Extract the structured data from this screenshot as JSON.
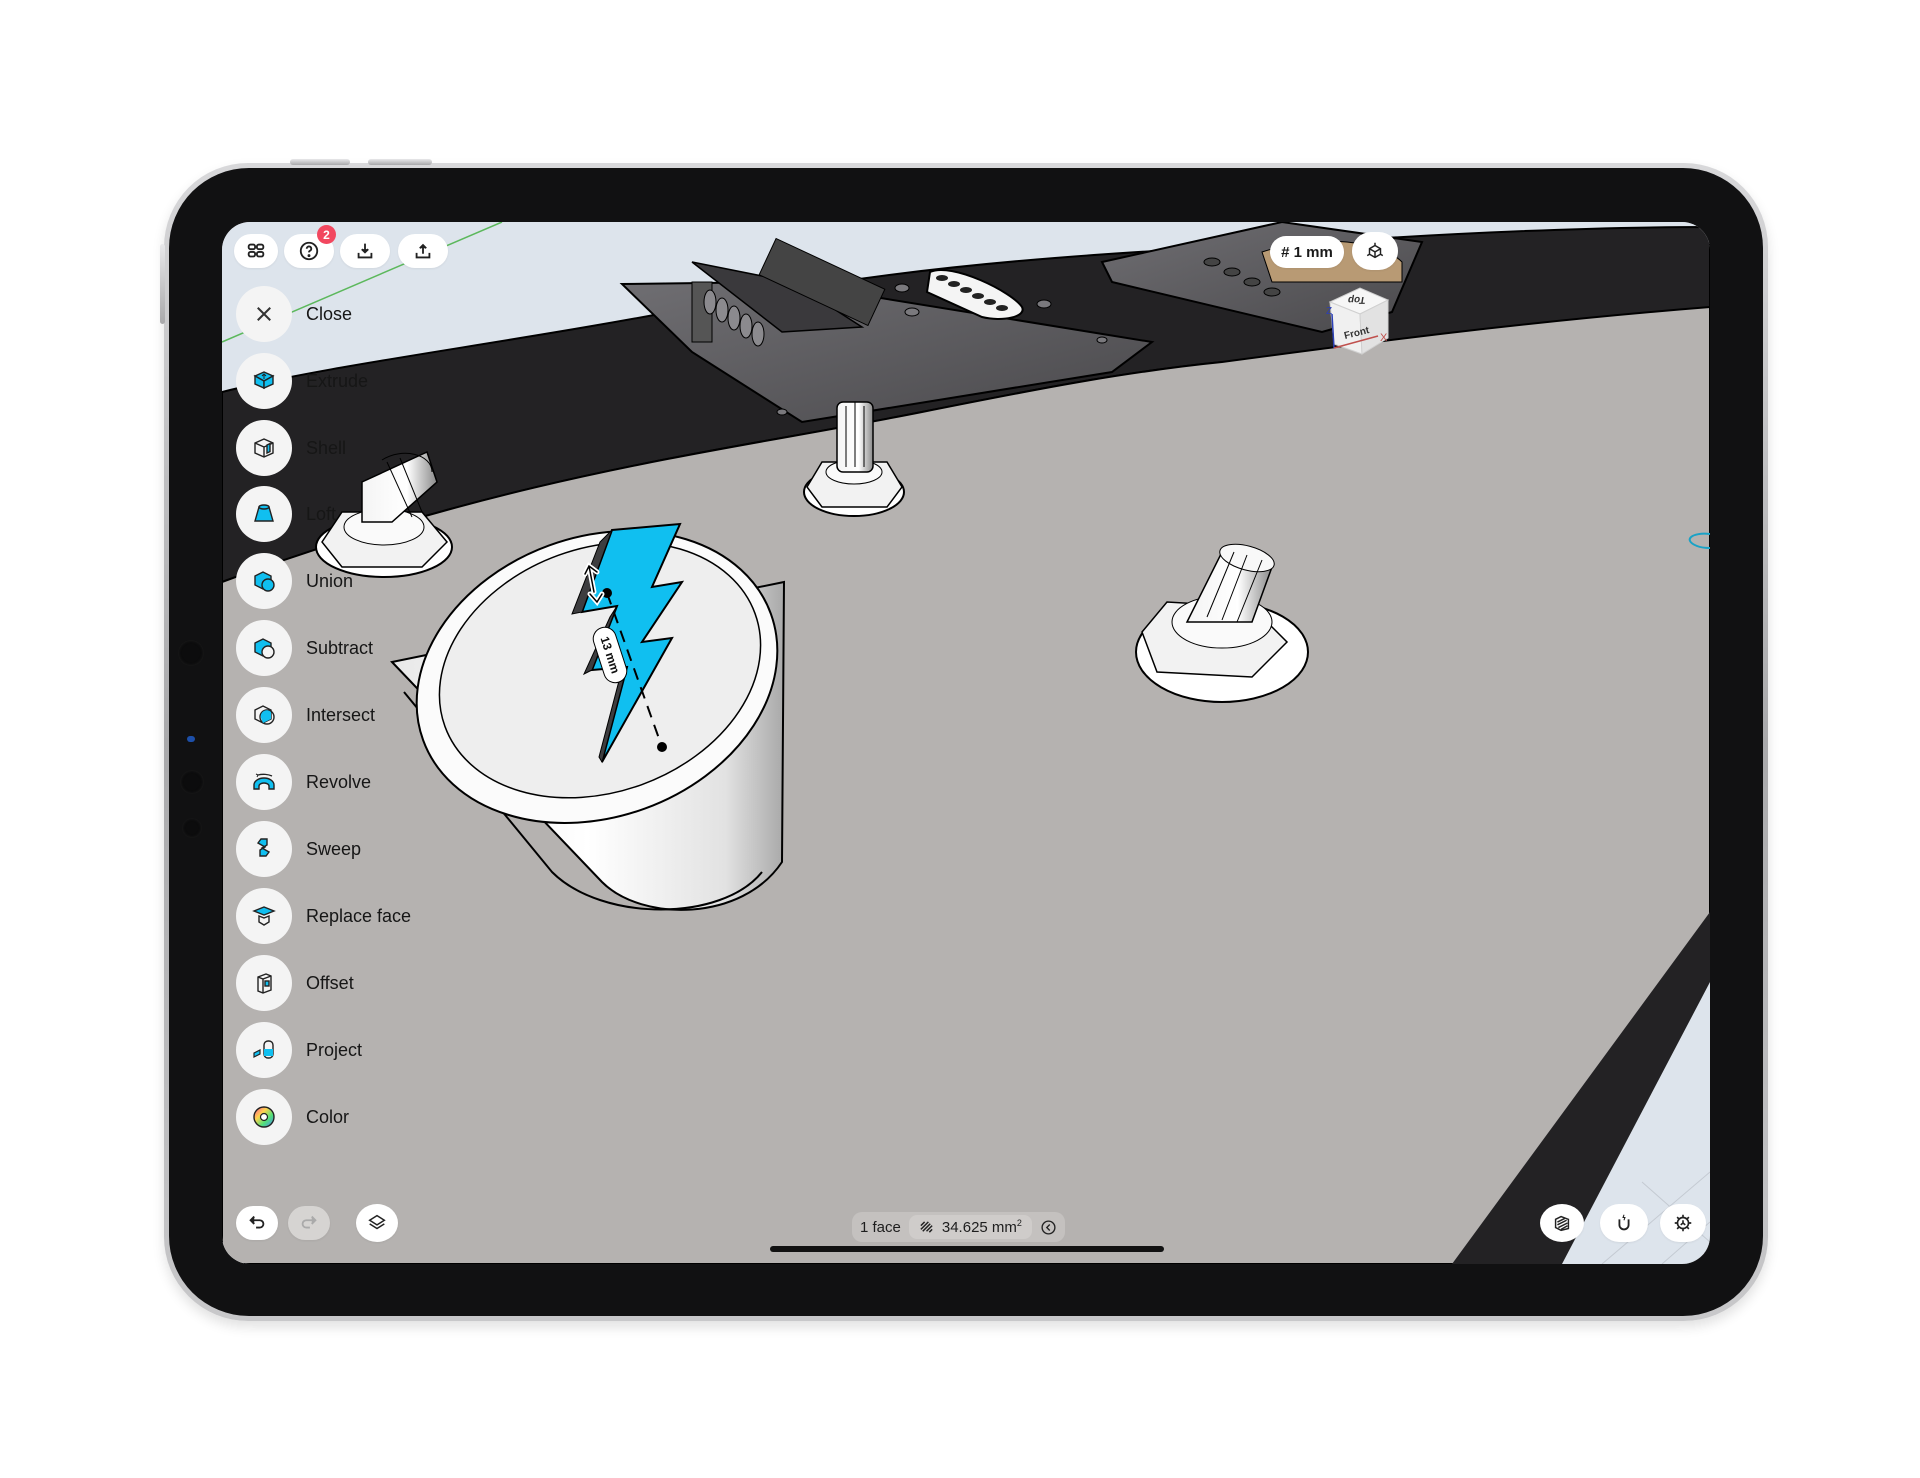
{
  "app": {
    "top_toolbar": {
      "buttons": [
        {
          "name": "apps-grid",
          "icon": "grid-icon"
        },
        {
          "name": "help",
          "icon": "question-circle-icon",
          "badge": "2"
        },
        {
          "name": "import",
          "icon": "download-tray-icon"
        },
        {
          "name": "export",
          "icon": "upload-tray-icon"
        }
      ]
    },
    "top_right": {
      "grid_unit": "# 1 mm",
      "view_button_icon": "cube-axes-icon",
      "view_cube": {
        "top_label": "Top",
        "front_label": "Front",
        "axis_x": "X",
        "axis_z": "Z"
      }
    },
    "tool_menu": {
      "close_label": "Close",
      "items": [
        {
          "label": "Extrude",
          "icon": "extrude-icon"
        },
        {
          "label": "Shell",
          "icon": "shell-icon"
        },
        {
          "label": "Loft",
          "icon": "loft-icon"
        },
        {
          "label": "Union",
          "icon": "union-icon"
        },
        {
          "label": "Subtract",
          "icon": "subtract-icon"
        },
        {
          "label": "Intersect",
          "icon": "intersect-icon"
        },
        {
          "label": "Revolve",
          "icon": "revolve-icon"
        },
        {
          "label": "Sweep",
          "icon": "sweep-icon"
        },
        {
          "label": "Replace face",
          "icon": "replace-face-icon"
        },
        {
          "label": "Offset",
          "icon": "offset-icon"
        },
        {
          "label": "Project",
          "icon": "project-icon"
        },
        {
          "label": "Color",
          "icon": "color-wheel-icon"
        }
      ]
    },
    "bottom_left": {
      "undo_icon": "undo-icon",
      "redo_icon": "redo-icon",
      "redo_enabled": false,
      "layers_icon": "layers-icon"
    },
    "status_bar": {
      "selection": "1 face",
      "area_value": "34.625 mm",
      "area_exponent": "2",
      "area_icon": "hatch-icon",
      "collapse_icon": "chevron-left-circle-icon"
    },
    "bottom_right": {
      "buttons": [
        {
          "name": "section-view",
          "icon": "section-box-icon"
        },
        {
          "name": "snapping",
          "icon": "magnet-icon"
        },
        {
          "name": "settings",
          "icon": "gear-icon"
        }
      ]
    },
    "viewport": {
      "dimension_label": "13 mm",
      "accent_color": "#10bff0",
      "background_color": "#b5b2b0",
      "body_color": "#232224",
      "sky_color": "#dde4ec"
    }
  }
}
